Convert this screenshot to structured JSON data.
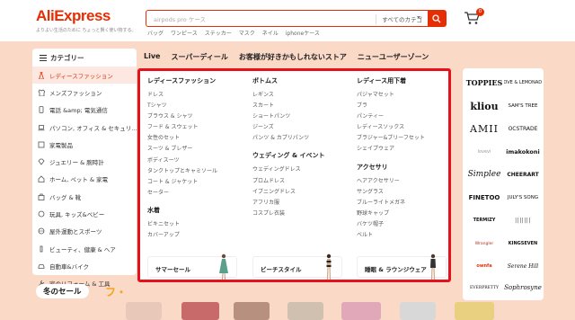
{
  "header": {
    "logo": "AliExpress",
    "tagline": "よりよい生活のために ちょっと賢く使い物する。",
    "search_placeholder": "airpods pro ケース",
    "category_label": "すべてのカテゴ",
    "cart_count": "0",
    "quick_links": [
      "バッグ",
      "ワンピース",
      "ステッカー",
      "マスク",
      "ネイル",
      "iphoneケース"
    ]
  },
  "nav": [
    "Live",
    "スーパーディール",
    "お客様が好きかもしれないストア",
    "ニューユーザーゾーン"
  ],
  "sidebar": {
    "title": "カテゴリー",
    "items": [
      {
        "label": "レディースファッション",
        "icon": "dress-icon"
      },
      {
        "label": "メンズファッション",
        "icon": "shirt-icon"
      },
      {
        "label": "電話 &amp; 電気通信",
        "icon": "phone-icon"
      },
      {
        "label": "パソコン, オフィス & セキュリ...",
        "icon": "laptop-icon"
      },
      {
        "label": "家電製品",
        "icon": "appliance-icon"
      },
      {
        "label": "ジュエリー & 腕時計",
        "icon": "jewelry-icon"
      },
      {
        "label": "ホーム, ペット & 家電",
        "icon": "home-icon"
      },
      {
        "label": "バッグ & 靴",
        "icon": "bag-icon"
      },
      {
        "label": "玩具, キッズ&ベビー",
        "icon": "toy-icon"
      },
      {
        "label": "屋外運動とスポーツ",
        "icon": "sports-icon"
      },
      {
        "label": "ビューティ、健康 & ヘア",
        "icon": "beauty-icon"
      },
      {
        "label": "自動車&バイク",
        "icon": "car-icon"
      },
      {
        "label": "家のリフォーム & 工具",
        "icon": "tools-icon"
      }
    ]
  },
  "panel": {
    "col1": {
      "title": "レディースファッション",
      "items": [
        "ドレス",
        "Tシャツ",
        "ブラウス & シャツ",
        "フード & スウェット",
        "女性のセット",
        "スーツ & ブレザー",
        "ボディスーツ",
        "タンクトップとキャミソール",
        "コート & ジャケット",
        "セーター"
      ],
      "sub_title": "水着",
      "sub_items": [
        "ビキニセット",
        "カバーアップ"
      ]
    },
    "col2": {
      "title": "ボトムス",
      "items": [
        "レギンス",
        "スカート",
        "ショートパンツ",
        "ジーンズ",
        "パンツ & カプリパンツ"
      ],
      "sub_title": "ウェディング & イベント",
      "sub_items": [
        "ウェディングドレス",
        "プロムドレス",
        "イブニングドレス",
        "アフリカ服",
        "コスプレ衣装"
      ]
    },
    "col3": {
      "title": "レディース用下着",
      "items": [
        "パジャマセット",
        "ブラ",
        "パンティー",
        "レディースソックス",
        "ブラジャー&ブリーフセット",
        "シェイプウェア"
      ],
      "sub_title": "アクセサリ",
      "sub_items": [
        "ヘアアクセサリー",
        "サングラス",
        "ブルーライトメガネ",
        "野球キャップ",
        "バケツ帽子",
        "ベルト"
      ]
    },
    "promos": [
      "サマーセール",
      "ビーチスタイル",
      "睡眠 & ラウンジウェア"
    ]
  },
  "brands": [
    "TOPPIES",
    "LOVE & LEMONADE",
    "kliou",
    "SAM'S TREE",
    "AMII",
    "OCSTRADE",
    "lovevi",
    "imakokoni",
    "Simplee",
    "CHEERART",
    "FINETOO",
    "JULY'S SONG",
    "TERMIZY",
    "|||||||",
    "Wrangler",
    "KINGSEVEN",
    "ownfa",
    "Serene Hill",
    "EVERPRETTY",
    "Sophrosyne"
  ],
  "sale_banner": "冬のセール",
  "sale_deco": "フ・",
  "colors": {
    "accent": "#e62e04",
    "panel_border": "#e8101a",
    "background": "#fbd9c7"
  }
}
